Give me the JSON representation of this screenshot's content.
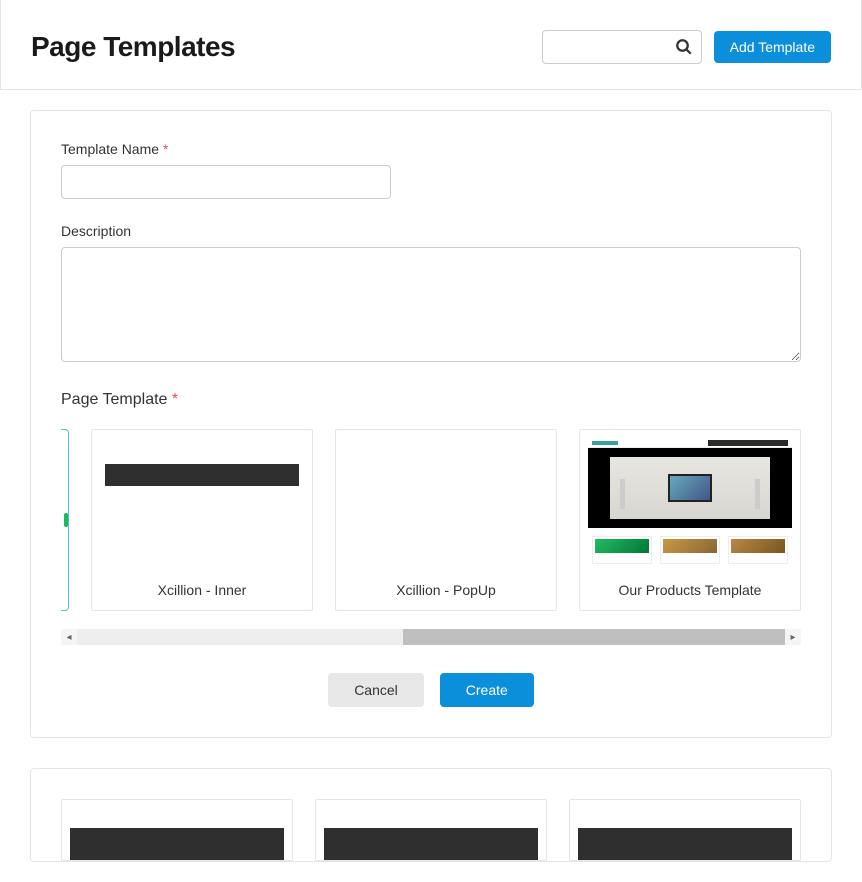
{
  "header": {
    "title": "Page Templates",
    "add_button": "Add Template",
    "search_placeholder": ""
  },
  "form": {
    "name_label": "Template Name",
    "name_value": "",
    "description_label": "Description",
    "description_value": "",
    "page_template_heading": "Page Template",
    "cancel_label": "Cancel",
    "create_label": "Create"
  },
  "templates": [
    {
      "name": "Xcillion - Inner"
    },
    {
      "name": "Xcillion - PopUp"
    },
    {
      "name": "Our Products Template"
    }
  ]
}
